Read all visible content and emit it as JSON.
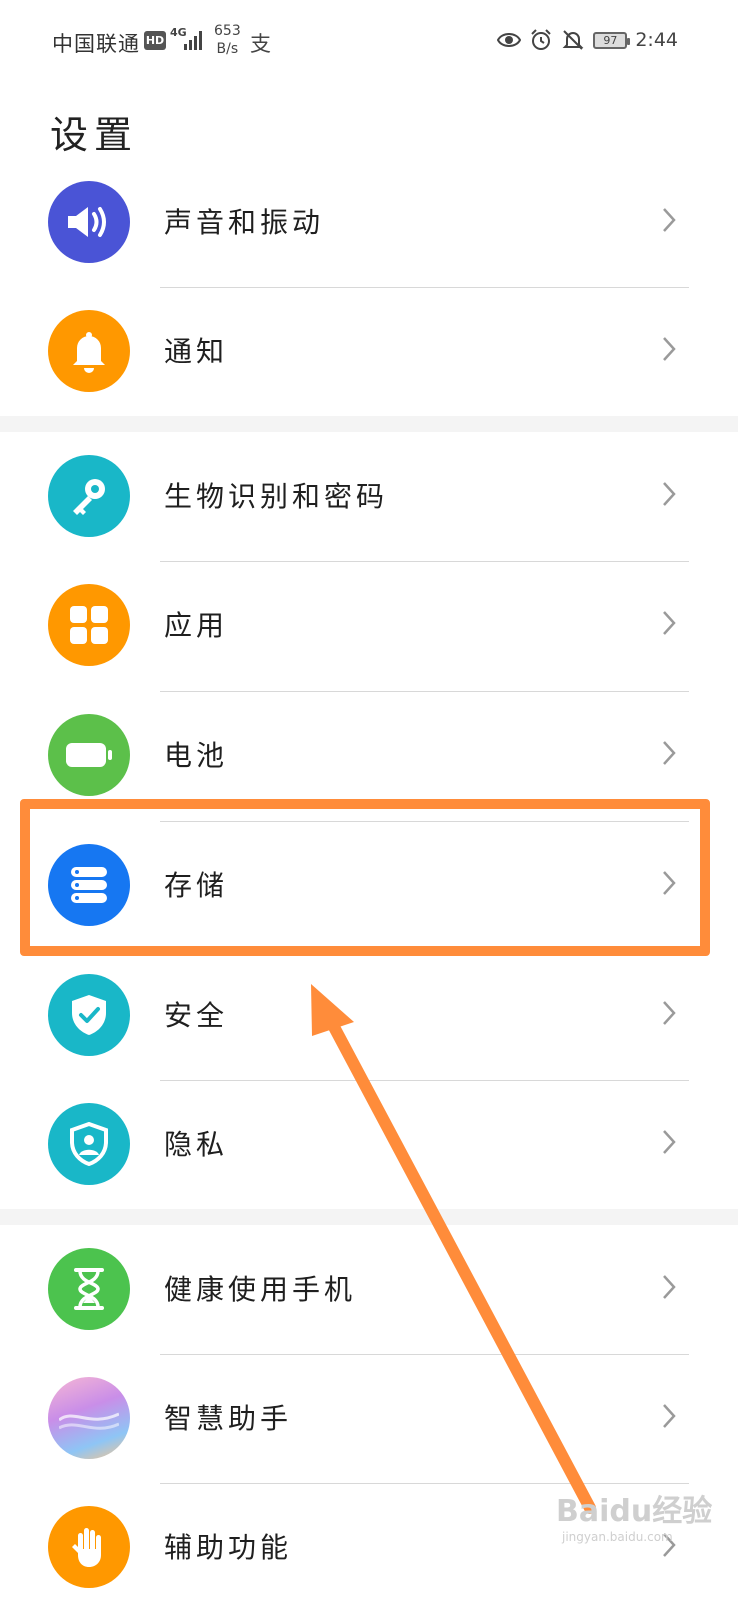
{
  "status_bar": {
    "carrier": "中国联通",
    "hd": "HD",
    "network": "4G",
    "speed_value": "653",
    "speed_unit": "B/s",
    "pay_glyph": "支",
    "battery": "97",
    "time": "2:44"
  },
  "page_title": "设置",
  "items": [
    {
      "label": "声音和振动",
      "color": "#4a54d6",
      "icon": "speaker-icon"
    },
    {
      "label": "通知",
      "color": "#ff9800",
      "icon": "bell-icon"
    },
    {
      "label": "生物识别和密码",
      "color": "#19b7c8",
      "icon": "key-icon"
    },
    {
      "label": "应用",
      "color": "#ff9800",
      "icon": "apps-grid-icon"
    },
    {
      "label": "电池",
      "color": "#5cc04a",
      "icon": "battery-icon"
    },
    {
      "label": "存储",
      "color": "#1677f2",
      "icon": "storage-icon"
    },
    {
      "label": "安全",
      "color": "#19b7c8",
      "icon": "shield-check-icon"
    },
    {
      "label": "隐私",
      "color": "#19b7c8",
      "icon": "privacy-shield-icon"
    },
    {
      "label": "健康使用手机",
      "color": "#4cc34e",
      "icon": "hourglass-icon"
    },
    {
      "label": "智慧助手",
      "color": "#c98ee8",
      "icon": "assistant-icon"
    },
    {
      "label": "辅助功能",
      "color": "#ff9800",
      "icon": "hand-icon"
    }
  ],
  "annotation_color": "#ff8c3a",
  "watermark": "Baidu经验",
  "watermark_sub": "jingyan.baidu.com"
}
